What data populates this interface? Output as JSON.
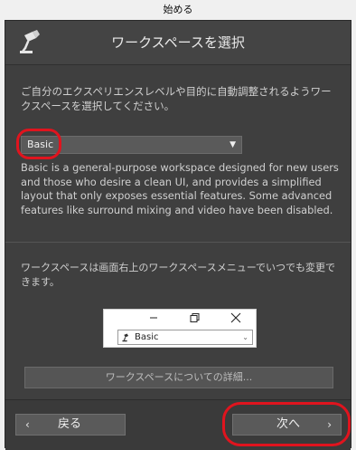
{
  "window": {
    "title": "始める"
  },
  "header": {
    "title": "ワークスペースを選択",
    "icon": "desk-lamp-icon"
  },
  "intro_text": "ご自分のエクスペリエンスレベルや目的に自動調整されるようワークスペースを選択してください。",
  "workspace_select": {
    "value": "Basic",
    "arrow": "▼"
  },
  "description": "Basic is a general-purpose workspace designed for new users and those who desire a clean UI, and provides a simplified layout that only exposes essential features. Some advanced features like surround mixing and video have been disabled.",
  "change_note": "ワークスペースは画面右上のワークスペースメニューでいつでも変更できます。",
  "mini_window": {
    "controls": [
      "minimize-icon",
      "maximize-icon",
      "close-icon"
    ],
    "select_value": "Basic",
    "select_arrow": "⌄"
  },
  "details_button": {
    "label": "ワークスペースについての詳細..."
  },
  "footer": {
    "back_label": "戻る",
    "back_chevron": "‹",
    "next_label": "次へ",
    "next_chevron": "›"
  },
  "colors": {
    "highlight": "#e0141e",
    "panel": "#3f3f3f"
  }
}
